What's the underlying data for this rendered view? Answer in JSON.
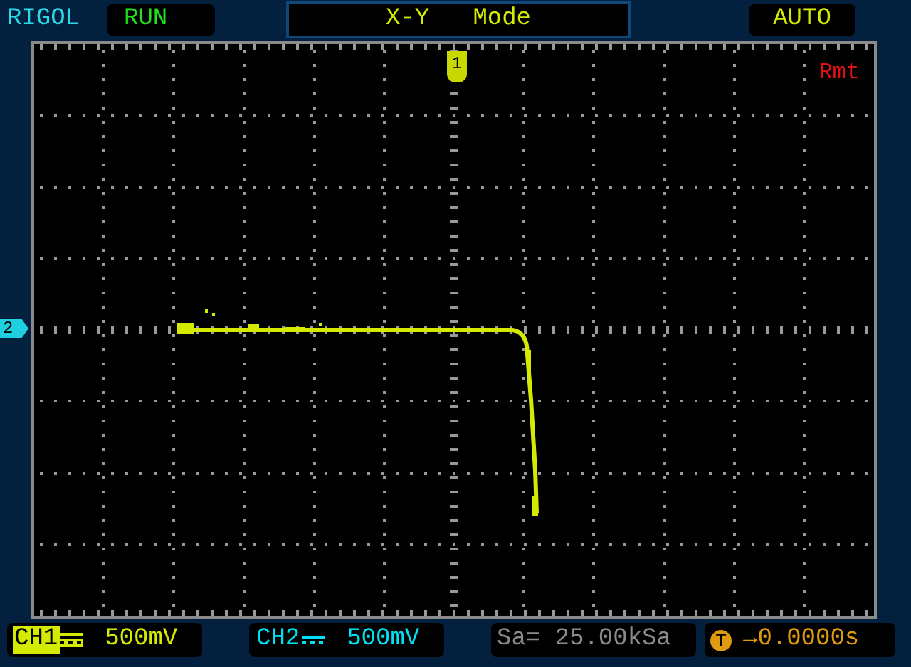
{
  "header": {
    "brand": "RIGOL",
    "status": "RUN",
    "title": "X-Y   Mode",
    "trigger_mode": "AUTO"
  },
  "screen": {
    "remote": "Rmt",
    "ch1_marker": "1",
    "ch2_marker": "2"
  },
  "footer": [
    {
      "kind": "channel",
      "label": "CH1",
      "value": "500mV",
      "color": "#d4ea00",
      "selected": true
    },
    {
      "kind": "channel",
      "label": "CH2",
      "value": "500mV",
      "color": "#00e0f0",
      "selected": false
    },
    {
      "kind": "sample",
      "text": "Sa= 25.00kSa"
    },
    {
      "kind": "trigger",
      "symbol": "T",
      "text": "→0.0000s"
    }
  ]
}
